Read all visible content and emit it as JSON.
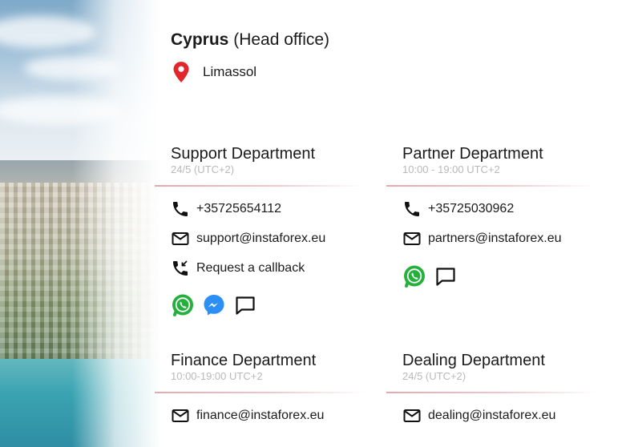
{
  "office": {
    "country": "Cyprus",
    "label": "(Head office)",
    "city": "Limassol"
  },
  "departments": {
    "support": {
      "name": "Support Department",
      "hours": "24/5 (UTC+2)",
      "phone": "+35725654112",
      "email": "support@instaforex.eu",
      "callback": "Request a callback"
    },
    "partner": {
      "name": "Partner Department",
      "hours": "10:00 - 19:00 UTC+2",
      "phone": "+35725030962",
      "email": "partners@instaforex.eu"
    },
    "finance": {
      "name": "Finance Department",
      "hours": "10:00-19:00 UTC+2",
      "email": "finance@instaforex.eu"
    },
    "dealing": {
      "name": "Dealing Department",
      "hours": "24/5 (UTC+2)",
      "email": "dealing@instaforex.eu"
    }
  },
  "icons": {
    "location": "map-pin-icon",
    "phone": "phone-icon",
    "email": "email-icon",
    "callback": "phone-callback-icon",
    "whatsapp": "whatsapp-icon",
    "messenger": "messenger-icon",
    "chat": "chat-icon"
  },
  "colors": {
    "pin": "#e3262c",
    "whatsapp": "#25b03d",
    "messenger": "#2b8ff5",
    "divider": "#e4a9b0",
    "hours_text": "#b9b9b9"
  }
}
